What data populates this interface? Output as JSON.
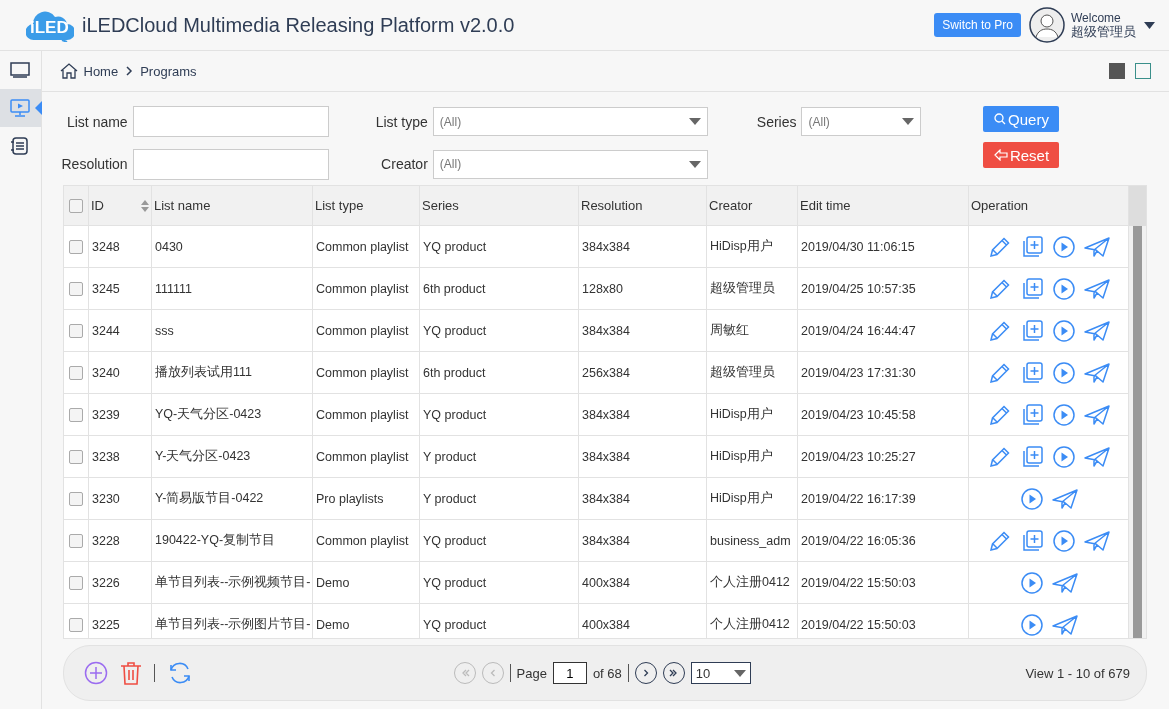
{
  "header": {
    "logo_text": "iLED",
    "title": "iLEDCloud Multimedia Releasing Platform v2.0.0",
    "switch_button": "Switch to Pro",
    "welcome": "Welcome",
    "user": "超级管理员"
  },
  "sidebar": {
    "items": [
      {
        "selected": false
      },
      {
        "selected": true
      },
      {
        "selected": false
      }
    ]
  },
  "breadcrumb": [
    "Home",
    "Programs"
  ],
  "view_modes": [
    {
      "selected": true
    },
    {
      "selected": false
    }
  ],
  "filters": [
    {
      "label": "List name",
      "kind": "text"
    },
    {
      "label": "List type",
      "kind": "select",
      "value": "(All)"
    },
    {
      "label": "Series",
      "kind": "select",
      "value": "(All)"
    },
    {
      "label": "Resolution",
      "kind": "text"
    },
    {
      "label": "Creator",
      "kind": "select",
      "value": "(All)"
    }
  ],
  "query_button": "Query",
  "reset_button": "Reset",
  "table": {
    "select_all_checked": false,
    "columns": [
      {
        "label": "ID",
        "sortable": true
      },
      {
        "label": "List name",
        "sortable": false
      },
      {
        "label": "List type",
        "sortable": false
      },
      {
        "label": "Series",
        "sortable": false
      },
      {
        "label": "Resolution",
        "sortable": false
      },
      {
        "label": "Creator",
        "sortable": false
      },
      {
        "label": "Edit time",
        "sortable": false
      },
      {
        "label": "Operation",
        "sortable": false
      }
    ],
    "rows": [
      {
        "checked": false,
        "editable": true,
        "cells": [
          "3248",
          "0430",
          "Common playlist",
          "YQ product",
          "384x384",
          "HiDisp用户",
          "2019/04/30 11:06:15"
        ]
      },
      {
        "checked": false,
        "editable": true,
        "cells": [
          "3245",
          "111111",
          "Common playlist",
          "6th product",
          "128x80",
          "超级管理员",
          "2019/04/25 10:57:35"
        ]
      },
      {
        "checked": false,
        "editable": true,
        "cells": [
          "3244",
          "sss",
          "Common playlist",
          "YQ product",
          "384x384",
          "周敏红",
          "2019/04/24 16:44:47"
        ]
      },
      {
        "checked": false,
        "editable": true,
        "cells": [
          "3240",
          "播放列表试用111",
          "Common playlist",
          "6th product",
          "256x384",
          "超级管理员",
          "2019/04/23 17:31:30"
        ]
      },
      {
        "checked": false,
        "editable": true,
        "cells": [
          "3239",
          "YQ-天气分区-0423",
          "Common playlist",
          "YQ product",
          "384x384",
          "HiDisp用户",
          "2019/04/23 10:45:58"
        ]
      },
      {
        "checked": false,
        "editable": true,
        "cells": [
          "3238",
          "Y-天气分区-0423",
          "Common playlist",
          "Y product",
          "384x384",
          "HiDisp用户",
          "2019/04/23 10:25:27"
        ]
      },
      {
        "checked": false,
        "editable": false,
        "cells": [
          "3230",
          "Y-简易版节目-0422",
          "Pro playlists",
          "Y product",
          "384x384",
          "HiDisp用户",
          "2019/04/22 16:17:39"
        ]
      },
      {
        "checked": false,
        "editable": true,
        "cells": [
          "3228",
          "190422-YQ-复制节目",
          "Common playlist",
          "YQ product",
          "384x384",
          "business_adm",
          "2019/04/22 16:05:36"
        ]
      },
      {
        "checked": false,
        "editable": false,
        "cells": [
          "3226",
          "单节目列表--示例视频节目-",
          "Demo",
          "YQ product",
          "400x384",
          "个人注册0412",
          "2019/04/22 15:50:03"
        ]
      },
      {
        "checked": false,
        "editable": false,
        "cells": [
          "3225",
          "单节目列表--示例图片节目-",
          "Demo",
          "YQ product",
          "400x384",
          "个人注册0412",
          "2019/04/22 15:50:03"
        ]
      }
    ]
  },
  "pager": {
    "first_disabled": true,
    "prev_disabled": true,
    "next_disabled": false,
    "last_disabled": false,
    "page_label": "Page",
    "page": "1",
    "of": "of 68",
    "per_page": "10",
    "view": "View 1 - 10 of 679"
  }
}
